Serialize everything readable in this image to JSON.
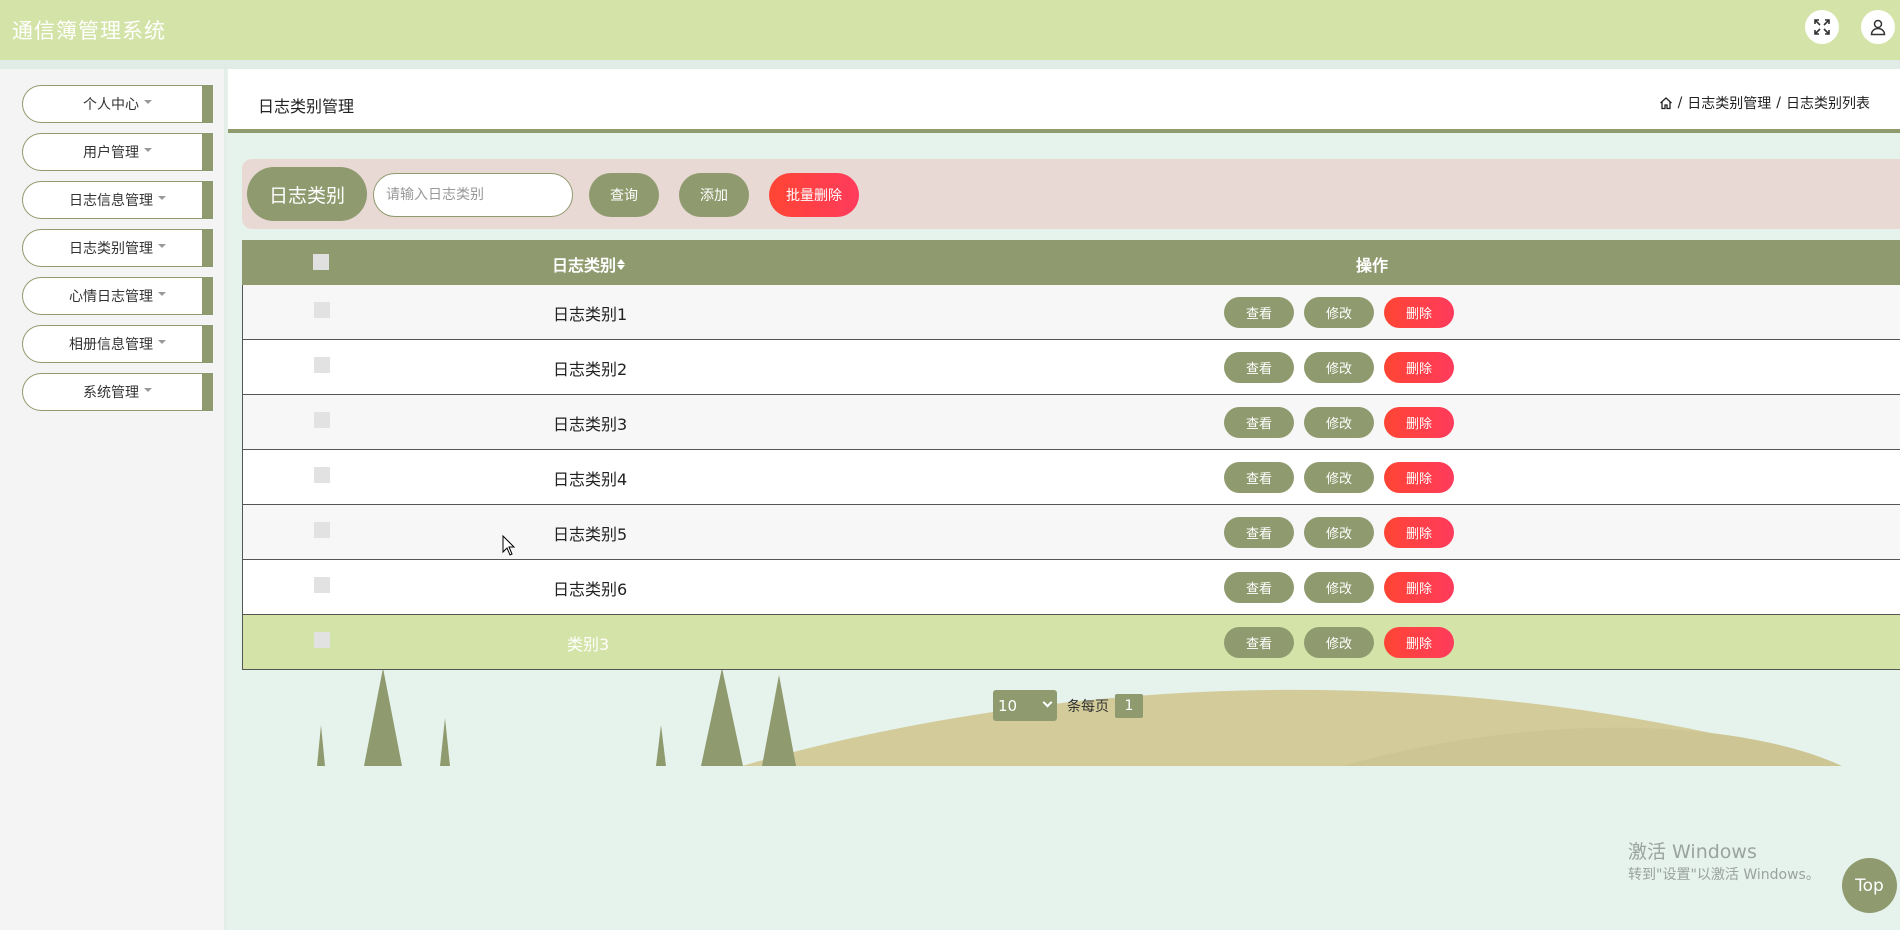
{
  "app": {
    "title": "通信簿管理系统"
  },
  "header": {
    "fullscreen_icon": "expand-icon",
    "user_icon": "user-icon"
  },
  "sidebar": {
    "items": [
      {
        "label": "个人中心"
      },
      {
        "label": "用户管理"
      },
      {
        "label": "日志信息管理"
      },
      {
        "label": "日志类别管理"
      },
      {
        "label": "心情日志管理"
      },
      {
        "label": "相册信息管理"
      },
      {
        "label": "系统管理"
      }
    ]
  },
  "page": {
    "title": "日志类别管理",
    "breadcrumb": [
      "日志类别管理",
      "日志类别列表"
    ]
  },
  "search": {
    "label": "日志类别",
    "placeholder": "请输入日志类别",
    "query_label": "查询",
    "add_label": "添加",
    "batch_delete_label": "批量删除"
  },
  "table": {
    "headers": {
      "name": "日志类别",
      "actions": "操作"
    },
    "rows": [
      {
        "name": "日志类别1"
      },
      {
        "name": "日志类别2"
      },
      {
        "name": "日志类别3"
      },
      {
        "name": "日志类别4"
      },
      {
        "name": "日志类别5"
      },
      {
        "name": "日志类别6"
      },
      {
        "name": "类别3"
      }
    ],
    "actions": {
      "view": "查看",
      "edit": "修改",
      "delete": "删除"
    }
  },
  "pagination": {
    "page_size": "10",
    "per_page_label": "条每页",
    "current_page": "1"
  },
  "watermark": {
    "line1": "激活 Windows",
    "line2": "转到\"设置\"以激活 Windows。"
  },
  "top_button": {
    "label": "Top"
  },
  "colors": {
    "accent": "#8f9a6e",
    "header_bg": "#d4e3a8",
    "danger": "#ff4534",
    "page_bg": "#e6f2ec"
  }
}
